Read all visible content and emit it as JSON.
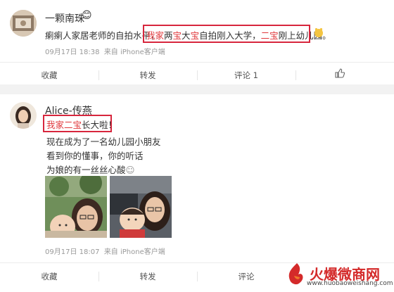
{
  "post1": {
    "username": "一颗南珠",
    "emoji": "😊",
    "text_start": "瘌瘌人家居老师的自拍水平，",
    "highlight_red1": "我家",
    "highlight_mid1": "两",
    "highlight_red2": "宝",
    "highlight_mid2": "大",
    "highlight_red3": "宝",
    "text_rest": "自拍刚入大学，",
    "text_red4": "二宝",
    "text_end": "刚上幼儿园。",
    "timestamp": "09月17日 18:38",
    "source": "来自 iPhone客户端",
    "actions": {
      "collect": "收藏",
      "repost": "转发",
      "comment": "评论",
      "comment_count": "1"
    }
  },
  "post2": {
    "username": "Alice-传燕",
    "highlight_a": "我家",
    "highlight_red": "二宝",
    "highlight_b": "长大啦！",
    "lines": [
      "现在成为了一名幼儿园小朋友",
      "看到你的懂事，你的听话",
      "为娘的有一丝丝心酸"
    ],
    "emoji": "☺",
    "timestamp": "09月17日 18:07",
    "source": "来自 iPhone客户端",
    "actions": {
      "collect": "收藏",
      "repost": "转发",
      "comment": "评论"
    }
  },
  "watermark": {
    "cn": "火爆微商网",
    "url": "www.huobaoweishang.com"
  }
}
